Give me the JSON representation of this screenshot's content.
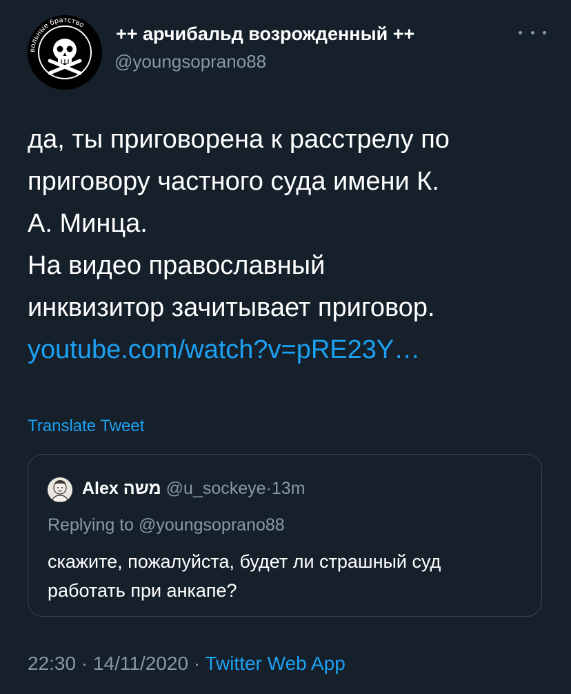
{
  "author": {
    "display_name": "++ арчибальд возрожденный ++",
    "handle": "@youngsoprano88",
    "avatar_icon": "skull-crossbones-emblem",
    "avatar_ring_text": "вольные братство"
  },
  "more_icon": "more-dots-icon",
  "tweet": {
    "lines": [
      "да, ты приговорена к расстрелу по",
      "приговору частного суда имени К.",
      "А. Минца.",
      "На видео православный",
      "инквизитор зачитывает приговор."
    ],
    "link": "youtube.com/watch?v=pRE23Y…"
  },
  "translate_label": "Translate Tweet",
  "quoted": {
    "name": "Alex משה",
    "handle": "@u_sockeye",
    "separator": "·",
    "time": "13m",
    "replying_to": "Replying to @youngsoprano88",
    "text": "скажите, пожалуйста, будет ли страшный суд работать при анкапе?"
  },
  "meta": {
    "time": "22:30",
    "separator1": " · ",
    "date": "14/11/2020",
    "separator2": " · ",
    "source": "Twitter Web App"
  },
  "colors": {
    "background": "#15202b",
    "text": "#ffffff",
    "secondary": "#8899a6",
    "link": "#1da1f2",
    "border": "#38444d"
  }
}
